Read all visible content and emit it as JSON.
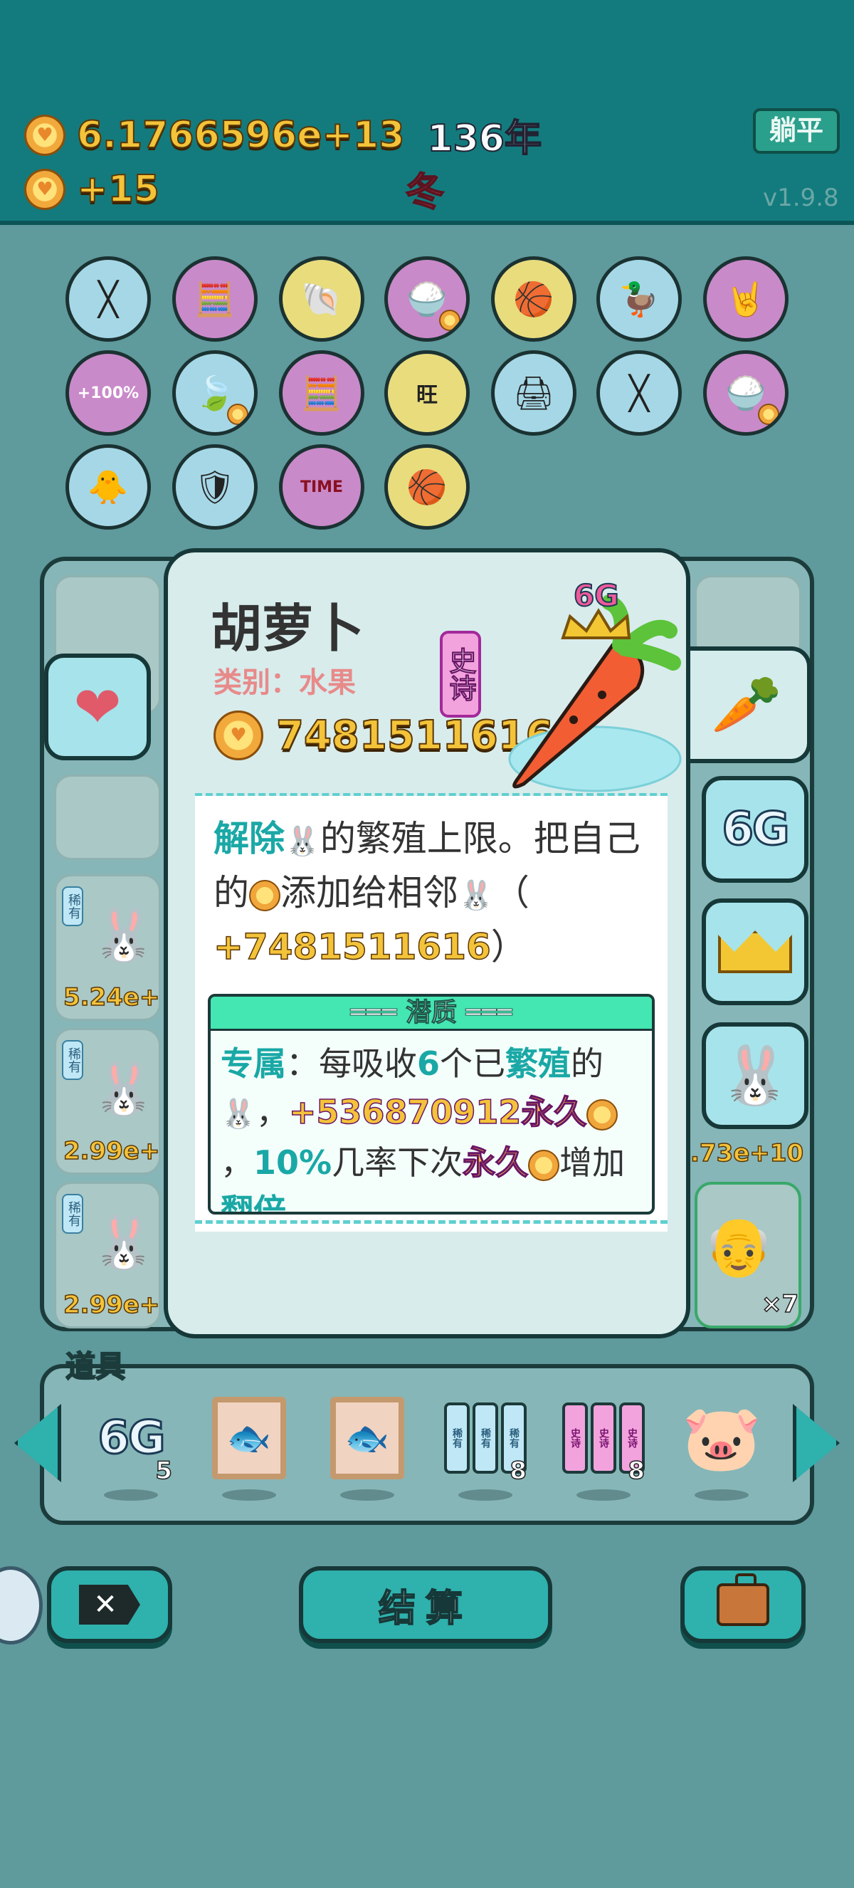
{
  "header": {
    "coins_total": "6.1766596e+13",
    "year": "136年",
    "coins_rate": "+15",
    "season": "冬",
    "lie_flat_button": "躺平",
    "version": "v1.9.8"
  },
  "item_grid": {
    "row1": [
      "chopsticks-icon",
      "math-student-icon",
      "shell-icon",
      "rice-bowl-icon",
      "basketballs-icon",
      "duck-pot-icon",
      "rock-hand-icon"
    ],
    "row2": [
      "cup-100-icon",
      "leaf-icon",
      "math-student-icon",
      "wang-text-icon",
      "printer-icon",
      "chopsticks-icon",
      "rice-bowl-icon"
    ],
    "row3": [
      "chick-egg-icon",
      "shield-wrench-icon",
      "time-magazine-icon",
      "basketballs-icon"
    ],
    "cup_text": "+100%",
    "wang_char": "旺",
    "time_text": "TIME"
  },
  "board": {
    "rare_tag": "稀有",
    "cell_values": [
      "5.24e+",
      "2.99e+",
      "2.99e+"
    ],
    "right_values": [
      ".73e+10"
    ],
    "multiplier": "×7"
  },
  "popup": {
    "name": "胡萝卜",
    "category": "类别：水果",
    "rarity": "史诗",
    "price": "7481511616",
    "badge_6g": "6G",
    "desc": {
      "p1": "解除",
      "p2": "的繁殖上限。把自己的",
      "p3": "添加给相邻",
      "p4": "（",
      "p5": "+7481511616",
      "p6": "）"
    },
    "potential": {
      "title": "═══ 潜质 ═══",
      "t1": "专属",
      "t2": "：每吸收",
      "t3": "6",
      "t4": "个已",
      "t5": "繁殖",
      "t6": "的",
      "t7": "，",
      "t8": "+536870912永久",
      "t9": "，",
      "t10": "10%",
      "t11": "几率下次",
      "t12": "永久",
      "t13": "增加",
      "t14": "翻倍",
      "t15": "。"
    }
  },
  "side_tabs": {
    "tab_6g": "6G"
  },
  "props": {
    "label": "道具",
    "items": [
      {
        "name": "6G",
        "count": "5"
      },
      {
        "name": "koi-frame",
        "count": ""
      },
      {
        "name": "koi-frame",
        "count": ""
      },
      {
        "name": "rare-cards",
        "count": "8"
      },
      {
        "name": "epic-cards",
        "count": "8"
      },
      {
        "name": "piggy-bank",
        "count": ""
      }
    ],
    "card_rare": "稀有",
    "card_epic": "史诗"
  },
  "bottom": {
    "settle_button": "结算"
  },
  "colors": {
    "header_bg": "#137b7d",
    "gold": "#f3c33a",
    "teal_accent": "#1aa8a6",
    "epic_pink": "#f2a3dd"
  }
}
